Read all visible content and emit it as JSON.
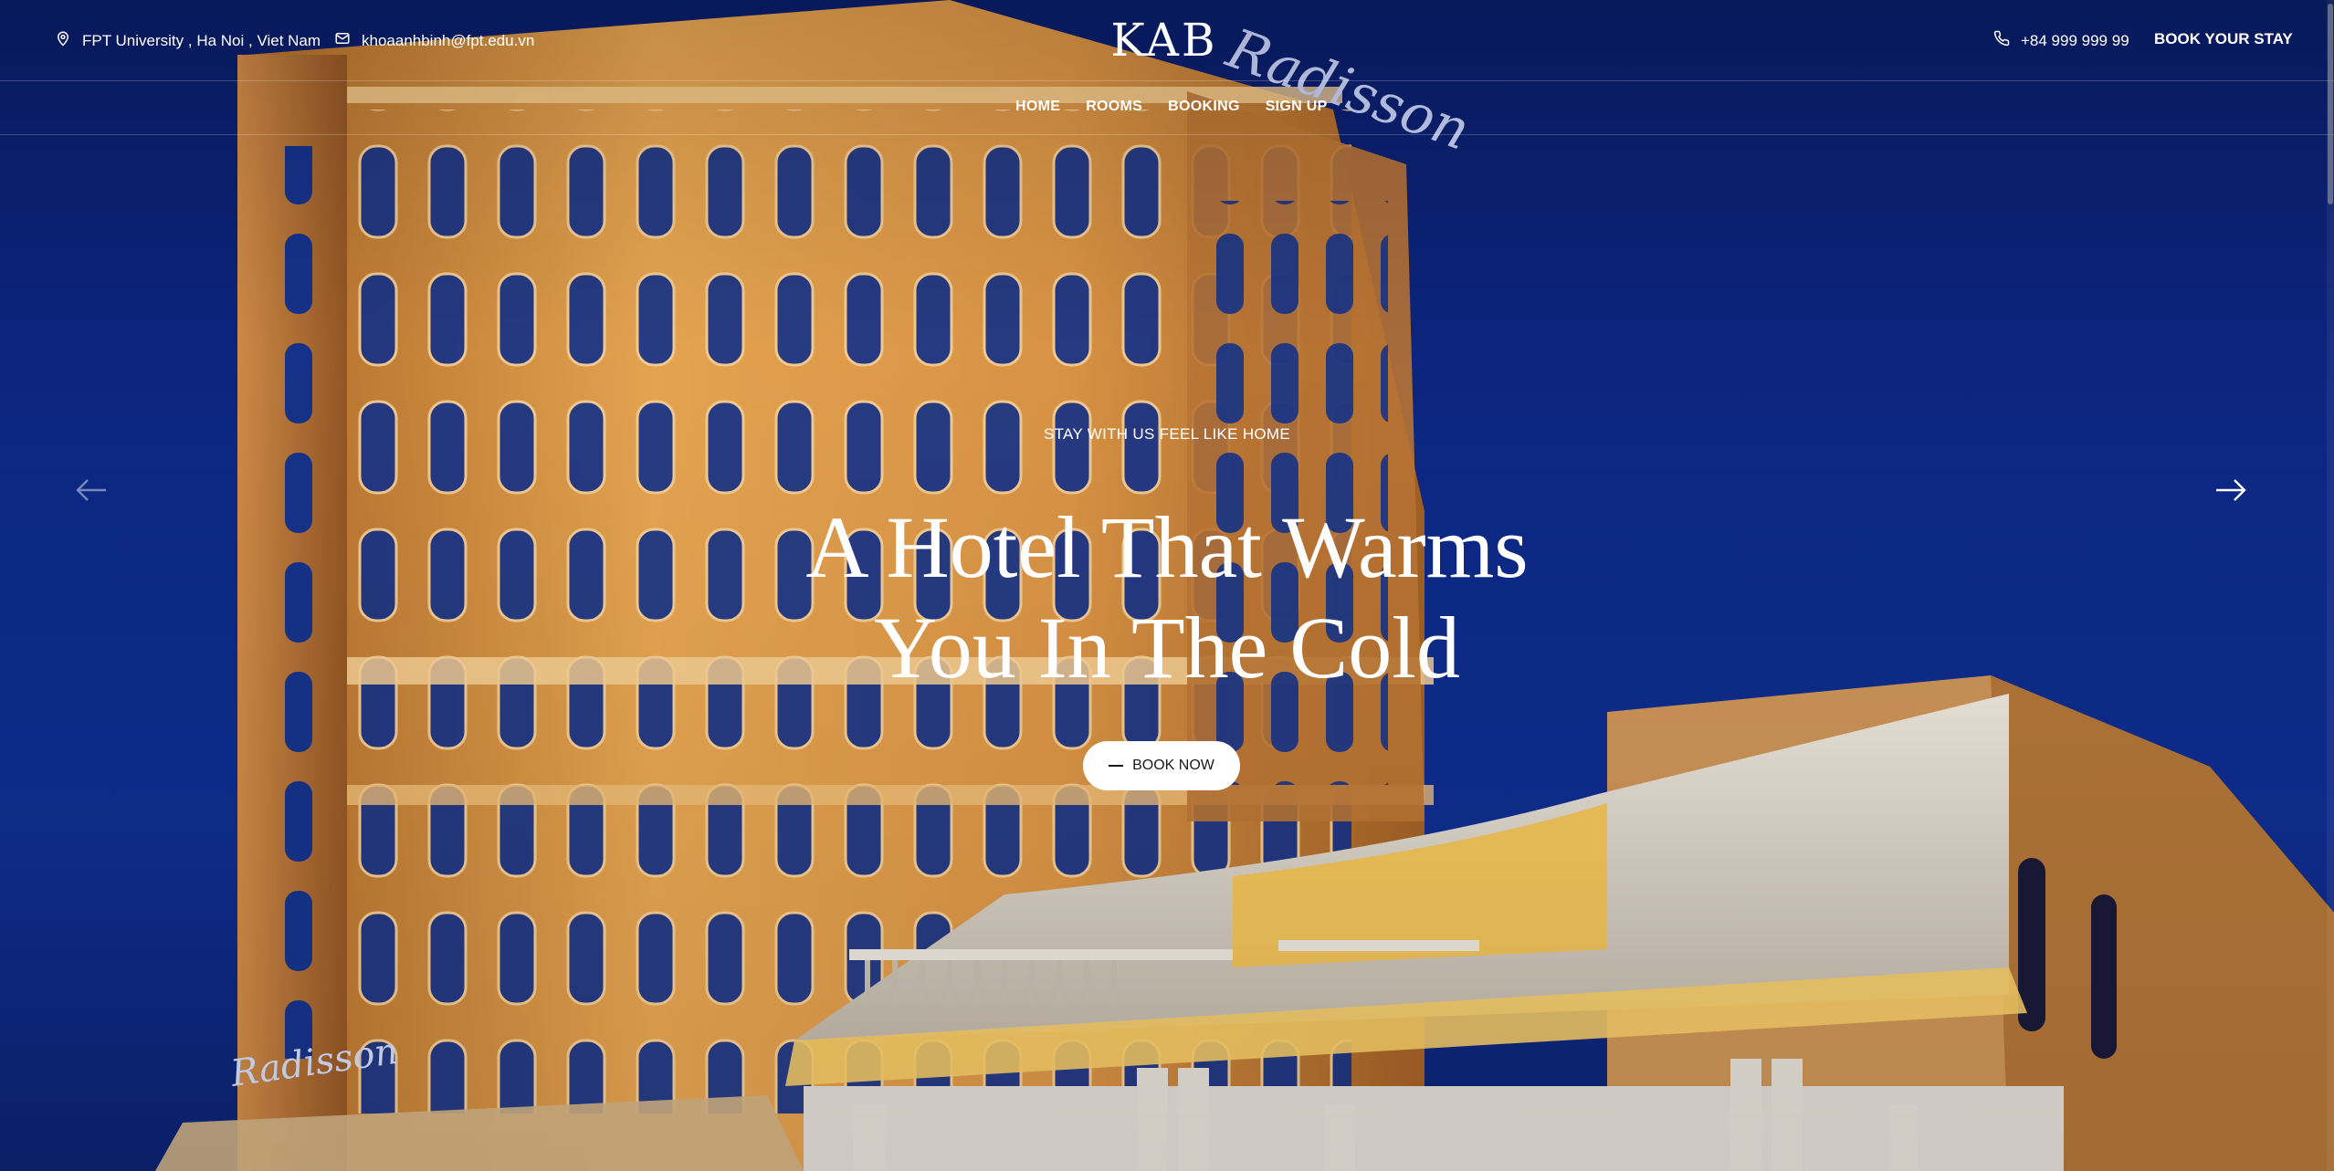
{
  "header": {
    "address": "FPT University , Ha Noi , Viet Nam",
    "email": "khoaanhbinh@fpt.edu.vn",
    "phone": "+84 999 999 99",
    "book_stay": "BOOK YOUR STAY",
    "logo": "KAB",
    "icons": {
      "address": "map-pin-icon",
      "email": "mail-icon",
      "phone": "phone-icon"
    }
  },
  "nav": {
    "items": [
      {
        "label": "HOME"
      },
      {
        "label": "ROOMS"
      },
      {
        "label": "BOOKING"
      },
      {
        "label": "SIGN UP"
      }
    ]
  },
  "hero": {
    "kicker": "STAY WITH US FEEL LIKE HOME",
    "headline_line1": "A Hotel That Warms",
    "headline_line2": "You In The Cold",
    "cta": "BOOK NOW",
    "prev_icon": "arrow-left-icon",
    "next_icon": "arrow-right-icon",
    "background": "night photo of illuminated hotel building"
  },
  "colors": {
    "sky": "#0d2a8c",
    "building": "#e8a048",
    "building_light": "#f6c27a",
    "window": "#12308a",
    "white": "#ffffff"
  }
}
